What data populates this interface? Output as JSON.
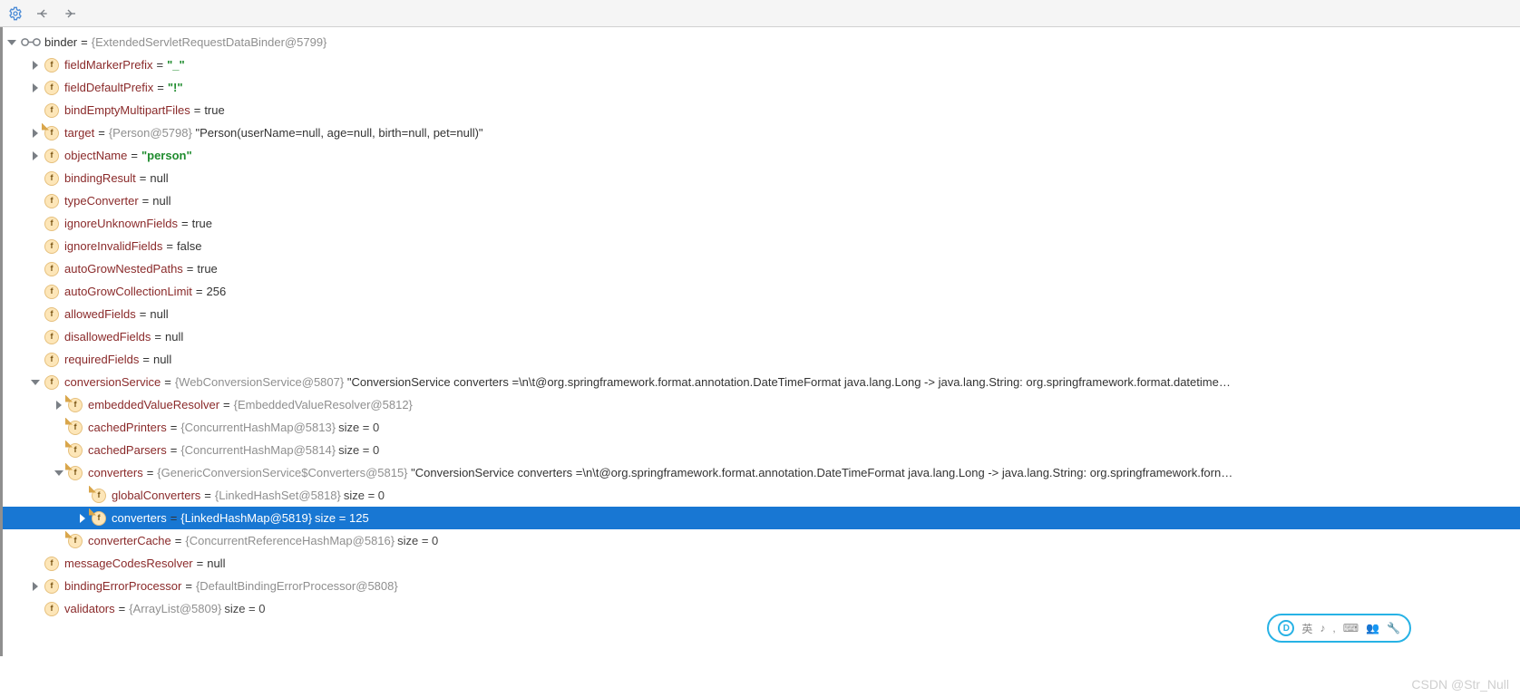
{
  "toolbar": {
    "settings_icon": "settings",
    "back_icon": "back",
    "forward_icon": "forward"
  },
  "root": {
    "name": "binder",
    "type": "{ExtendedServletRequestDataBinder@5799}"
  },
  "fields": {
    "fieldMarkerPrefix": {
      "name": "fieldMarkerPrefix",
      "value": "\"_\""
    },
    "fieldDefaultPrefix": {
      "name": "fieldDefaultPrefix",
      "value": "\"!\""
    },
    "bindEmptyMultipartFiles": {
      "name": "bindEmptyMultipartFiles",
      "value": "true"
    },
    "target": {
      "name": "target",
      "type": "{Person@5798}",
      "value": "\"Person(userName=null, age=null, birth=null, pet=null)\""
    },
    "objectName": {
      "name": "objectName",
      "value": "\"person\""
    },
    "bindingResult": {
      "name": "bindingResult",
      "value": "null"
    },
    "typeConverter": {
      "name": "typeConverter",
      "value": "null"
    },
    "ignoreUnknownFields": {
      "name": "ignoreUnknownFields",
      "value": "true"
    },
    "ignoreInvalidFields": {
      "name": "ignoreInvalidFields",
      "value": "false"
    },
    "autoGrowNestedPaths": {
      "name": "autoGrowNestedPaths",
      "value": "true"
    },
    "autoGrowCollectionLimit": {
      "name": "autoGrowCollectionLimit",
      "value": "256"
    },
    "allowedFields": {
      "name": "allowedFields",
      "value": "null"
    },
    "disallowedFields": {
      "name": "disallowedFields",
      "value": "null"
    },
    "requiredFields": {
      "name": "requiredFields",
      "value": "null"
    },
    "conversionService": {
      "name": "conversionService",
      "type": "{WebConversionService@5807}",
      "value": "\"ConversionService converters =\\n\\t@org.springframework.format.annotation.DateTimeFormat java.lang.Long -> java.lang.String: org.springframework.format.datetime…"
    },
    "embeddedValueResolver": {
      "name": "embeddedValueResolver",
      "type": "{EmbeddedValueResolver@5812}"
    },
    "cachedPrinters": {
      "name": "cachedPrinters",
      "type": "{ConcurrentHashMap@5813}",
      "size": " size = 0"
    },
    "cachedParsers": {
      "name": "cachedParsers",
      "type": "{ConcurrentHashMap@5814}",
      "size": " size = 0"
    },
    "converters": {
      "name": "converters",
      "type": "{GenericConversionService$Converters@5815}",
      "value": "\"ConversionService converters =\\n\\t@org.springframework.format.annotation.DateTimeFormat java.lang.Long -> java.lang.String: org.springframework.forn…"
    },
    "globalConverters": {
      "name": "globalConverters",
      "type": "{LinkedHashSet@5818}",
      "size": " size = 0"
    },
    "convertersMap": {
      "name": "converters",
      "type": "{LinkedHashMap@5819}",
      "size": " size = 125"
    },
    "converterCache": {
      "name": "converterCache",
      "type": "{ConcurrentReferenceHashMap@5816}",
      "size": " size = 0"
    },
    "messageCodesResolver": {
      "name": "messageCodesResolver",
      "value": "null"
    },
    "bindingErrorProcessor": {
      "name": "bindingErrorProcessor",
      "type": "{DefaultBindingErrorProcessor@5808}"
    },
    "validators": {
      "name": "validators",
      "type": "{ArrayList@5809}",
      "size": " size = 0"
    }
  },
  "watermark": "CSDN @Str_Null",
  "ime": {
    "lang": "英",
    "items": [
      "♪",
      ",",
      "⌨",
      "👥",
      "🔧"
    ]
  }
}
